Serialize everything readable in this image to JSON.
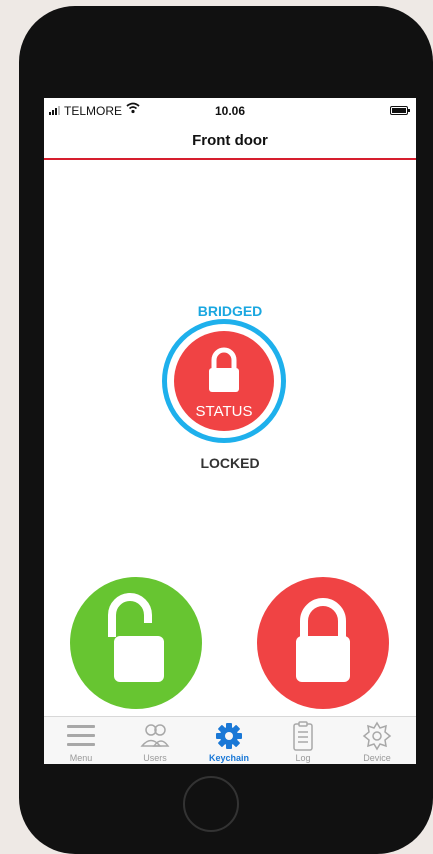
{
  "status_bar": {
    "carrier": "TELMORE",
    "time": "10.06"
  },
  "header": {
    "title": "Front door"
  },
  "lock_status": {
    "connection_label": "BRIDGED",
    "button_label": "STATUS",
    "state_label": "LOCKED",
    "ring_color": "#1eb0ec",
    "status_color": "#f04344"
  },
  "actions": {
    "unlock_color": "#67c531",
    "lock_color": "#f04344",
    "unlock_icon": "unlocked-padlock-icon",
    "lock_icon": "locked-padlock-icon"
  },
  "tabs": [
    {
      "label": "Menu",
      "icon": "menu-icon"
    },
    {
      "label": "Users",
      "icon": "users-icon"
    },
    {
      "label": "Keychain",
      "icon": "gear-icon",
      "active": true
    },
    {
      "label": "Log",
      "icon": "clipboard-icon"
    },
    {
      "label": "Device",
      "icon": "device-gear-icon"
    }
  ],
  "active_tab_color": "#1a78d6"
}
